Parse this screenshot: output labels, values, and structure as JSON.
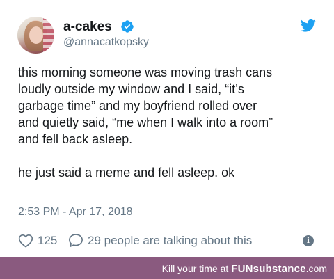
{
  "tweet": {
    "display_name": "a-cakes",
    "handle": "@annacatkopsky",
    "body_lines": [
      "this morning someone was moving trash cans",
      "loudly outside my window and I said, “it’s",
      "garbage time” and my boyfriend rolled over",
      "and quietly said, “me when I walk into a room”",
      "and fell back asleep."
    ],
    "body_last_line": "he just said a meme and fell asleep. ok",
    "timestamp": "2:53 PM - Apr 17, 2018",
    "like_count": "125",
    "talking_text": "29 people are talking about this"
  },
  "icons": {
    "verified": "verified-badge-icon",
    "bird": "twitter-bird-icon",
    "like": "heart-icon",
    "reply": "speech-bubble-icon",
    "info": "info-icon"
  },
  "colors": {
    "twitter_blue": "#1da1f2",
    "secondary_text": "#657786",
    "footer_bg": "#8a5a7f"
  },
  "footer": {
    "prefix": "Kill your time at ",
    "brand_fun": "FUN",
    "brand_rest": "substance",
    "brand_suffix": ".com"
  }
}
